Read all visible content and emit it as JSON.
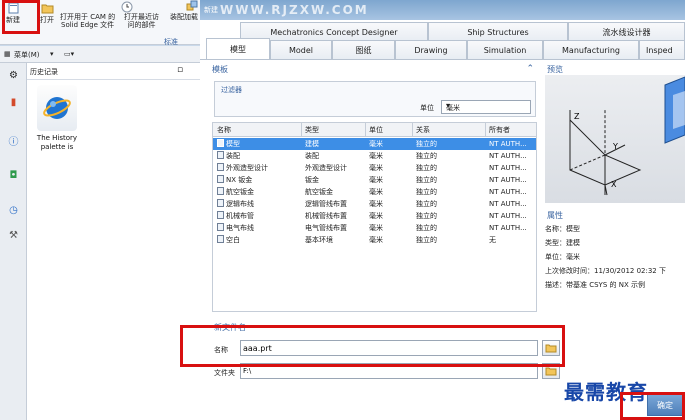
{
  "ribbon": {
    "new_label": "新建",
    "open_label": "打开",
    "cam_label_1": "打开用于 CAM 的",
    "cam_label_2": "Solid Edge 文件",
    "recent_label_1": "打开最近访",
    "recent_label_2": "问的部件",
    "assembly_label": "装配加载",
    "group_label": "标准"
  },
  "menu": {
    "label": "菜单(M)"
  },
  "history": {
    "title": "历史记录",
    "card_line1": "The History",
    "card_line2": "palette is"
  },
  "dialog": {
    "title": "新建",
    "watermark": "WWW.RJZXW.COM",
    "tabs_row1": [
      "Mechatronics Concept Designer",
      "Ship Structures",
      "流水线设计器"
    ],
    "tabs_row2": [
      "模型",
      "Model",
      "图纸",
      "Drawing",
      "Simulation",
      "Manufacturing",
      "Insped"
    ],
    "templates_head": "模板",
    "filter_label": "过滤器",
    "unit_label": "单位",
    "unit_value": "毫米",
    "preview_head": "预览",
    "columns": [
      "名称",
      "类型",
      "单位",
      "关系",
      "所有者"
    ],
    "rows": [
      [
        "模型",
        "建模",
        "毫米",
        "独立的",
        "NT AUTH..."
      ],
      [
        "装配",
        "装配",
        "毫米",
        "独立的",
        "NT AUTH..."
      ],
      [
        "外观造型设计",
        "外观造型设计",
        "毫米",
        "独立的",
        "NT AUTH..."
      ],
      [
        "NX 钣金",
        "钣金",
        "毫米",
        "独立的",
        "NT AUTH..."
      ],
      [
        "航空钣金",
        "航空钣金",
        "毫米",
        "独立的",
        "NT AUTH..."
      ],
      [
        "逻辑布线",
        "逻辑管线布置",
        "毫米",
        "独立的",
        "NT AUTH..."
      ],
      [
        "机械布管",
        "机械管线布置",
        "毫米",
        "独立的",
        "NT AUTH..."
      ],
      [
        "电气布线",
        "电气管线布置",
        "毫米",
        "独立的",
        "NT AUTH..."
      ],
      [
        "空白",
        "基本环境",
        "毫米",
        "独立的",
        "无"
      ]
    ],
    "props_head": "属性",
    "props": [
      "名称：模型",
      "类型：建模",
      "单位：毫米",
      "上次修改时间：11/30/2012 02:32 下",
      "描述：带基准 CSYS 的 NX 示例"
    ],
    "newfile_head": "新文件名",
    "name_label": "名称",
    "name_value": "aaa.prt",
    "folder_label": "文件夹",
    "folder_value": "F:\\",
    "ok_label": "确定",
    "axis_x": "X",
    "axis_y": "Y",
    "axis_z": "Z"
  },
  "footer_logo": "最需教育",
  "colors": {
    "accent": "#3a64a0",
    "selection": "#3d8ee6",
    "highlight_box": "#d81010",
    "logo": "#1847a8"
  }
}
